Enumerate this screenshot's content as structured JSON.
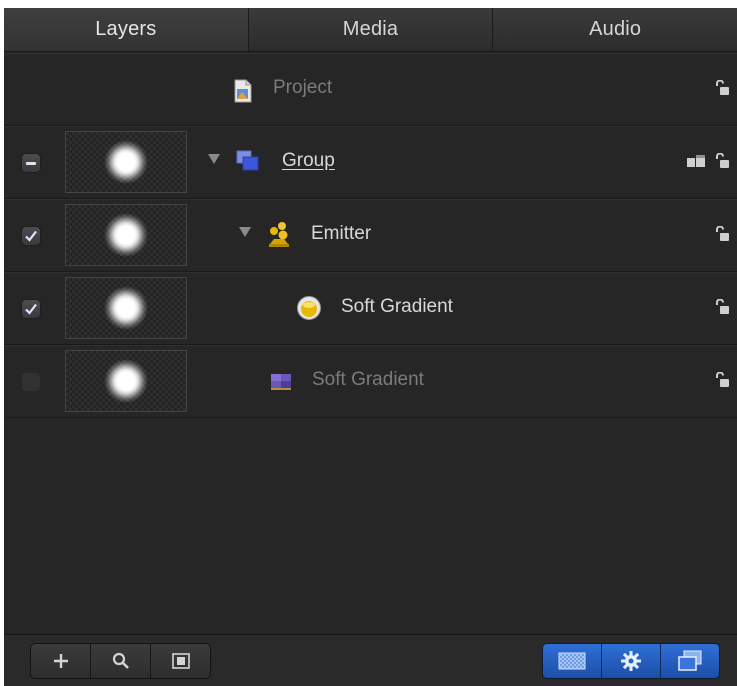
{
  "tabs": [
    {
      "label": "Layers",
      "active": true
    },
    {
      "label": "Media",
      "active": false
    },
    {
      "label": "Audio",
      "active": false
    }
  ],
  "layers": {
    "project": {
      "label": "Project",
      "icon": "project-icon"
    },
    "group": {
      "label": "Group",
      "icon": "group-icon",
      "checkbox": "mixed"
    },
    "emitter": {
      "label": "Emitter",
      "icon": "emitter-icon",
      "checkbox": "checked"
    },
    "cell": {
      "label": "Soft Gradient",
      "icon": "particle-cell-icon",
      "checkbox": "checked"
    },
    "source": {
      "label": "Soft Gradient",
      "icon": "image-layer-icon",
      "checkbox": "unchecked"
    }
  },
  "toolbar": {
    "left": [
      "add-icon",
      "search-icon",
      "thumbnail-icon"
    ],
    "right": [
      "checkerboard-icon",
      "gear-icon",
      "layers-stack-icon"
    ]
  },
  "colors": {
    "panel_bg": "#262626",
    "accent_blue": "#2f6fd6",
    "emitter_gold": "#e8b800"
  }
}
